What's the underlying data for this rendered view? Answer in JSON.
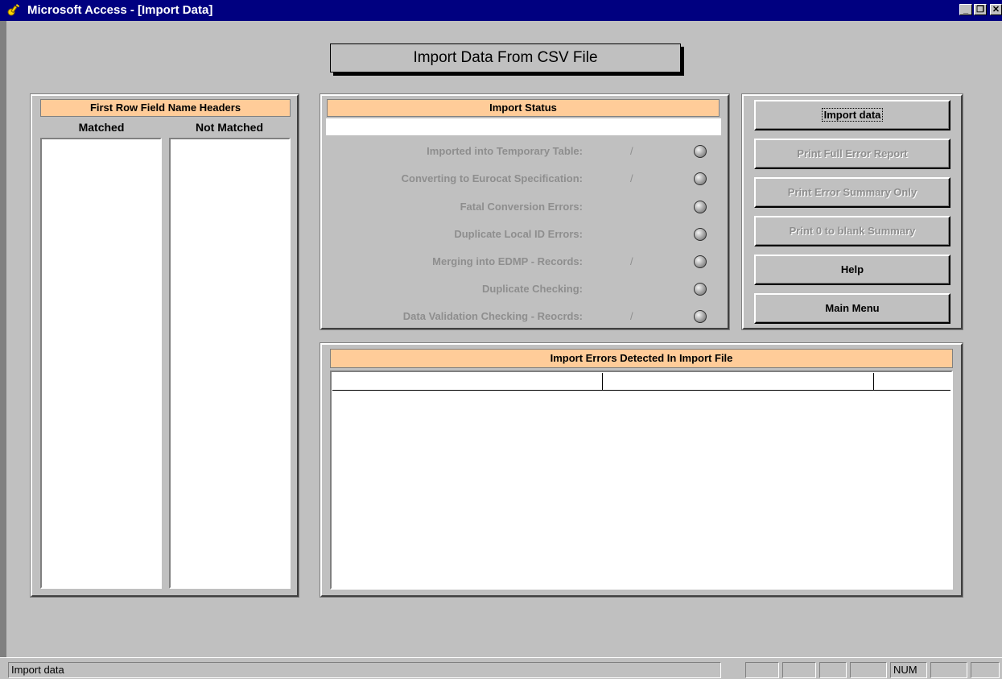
{
  "window": {
    "title": "Microsoft Access - [Import Data]",
    "app_icon": "access-key-icon",
    "controls": {
      "minimize": "_",
      "restore": "❐",
      "close": "✕"
    }
  },
  "form": {
    "header": "Import Data From CSV File"
  },
  "field_headers": {
    "title": "First Row Field Name Headers",
    "matched_label": "Matched",
    "not_matched_label": "Not Matched"
  },
  "import_status": {
    "title": "Import Status",
    "progress_text": "",
    "steps": [
      {
        "label": "Imported into Temporary Table:",
        "count": "/"
      },
      {
        "label": "Converting to Eurocat Specification:",
        "count": "/"
      },
      {
        "label": "Fatal Conversion Errors:",
        "count": ""
      },
      {
        "label": "Duplicate Local ID Errors:",
        "count": ""
      },
      {
        "label": "Merging into EDMP - Records:",
        "count": "/"
      },
      {
        "label": "Duplicate Checking:",
        "count": ""
      },
      {
        "label": "Data Validation Checking - Reocrds:",
        "count": "/"
      }
    ]
  },
  "actions": {
    "import_data": "Import data",
    "print_full_error_report": "Print Full Error Report",
    "print_error_summary_only": "Print Error Summary Only",
    "print_0_to_blank_summary": "Print 0 to blank Summary",
    "help": "Help",
    "main_menu": "Main Menu"
  },
  "errors": {
    "title": "Import Errors Detected In Import File"
  },
  "statusbar": {
    "message": "Import data",
    "num_indicator": "NUM"
  },
  "colors": {
    "title_bar": "#000080",
    "form_background": "#c0c0c0",
    "section_header": "#ffcc99",
    "disabled_text": "#8e8e8e"
  }
}
